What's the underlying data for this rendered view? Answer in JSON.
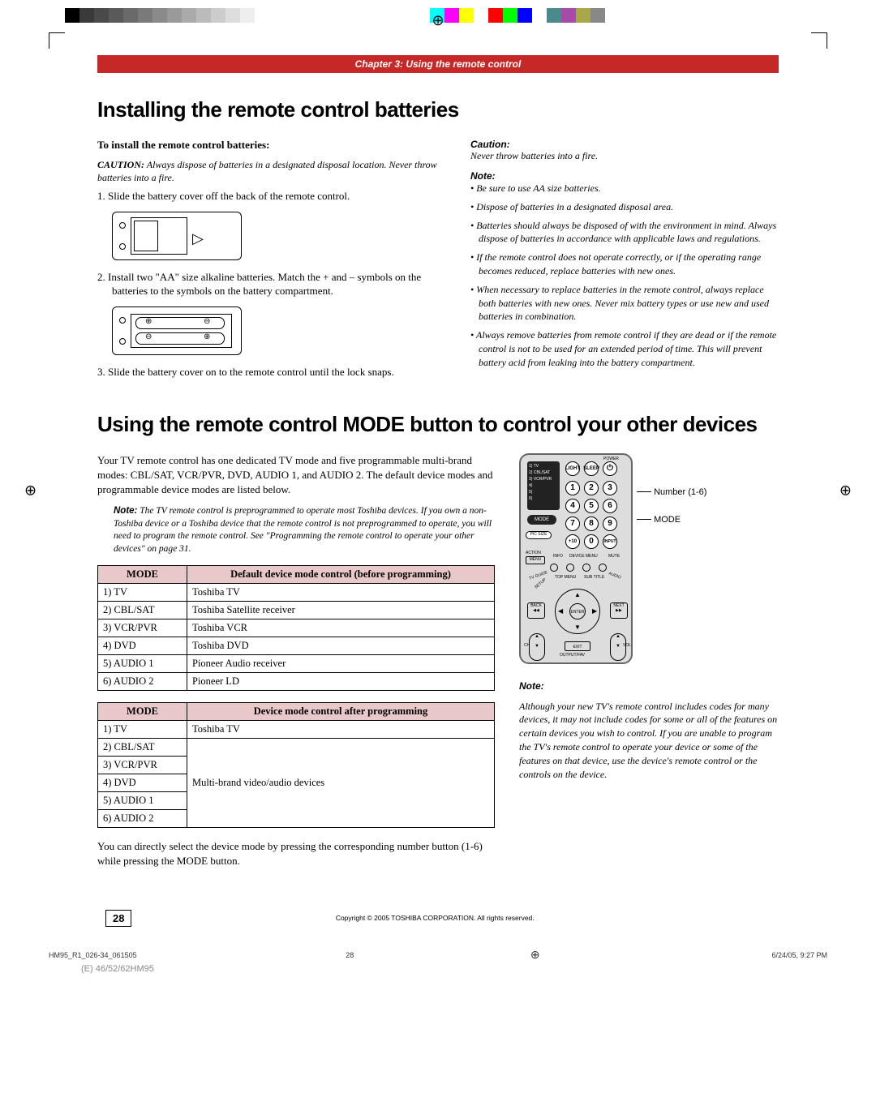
{
  "color_bar": [
    "#000",
    "#3a3a3a",
    "#4a4a4a",
    "#5a5a5a",
    "#6a6a6a",
    "#7a7a7a",
    "#8a8a8a",
    "#9a9a9a",
    "#aaa",
    "#bbb",
    "#ccc",
    "#ddd",
    "#eee",
    "#fff",
    "#fff",
    "#fff",
    "#fff",
    "#fff",
    "#fff",
    "#fff",
    "#fff",
    "#fff",
    "#fff",
    "#fff",
    "#fff",
    "#00ffff",
    "#ff00ff",
    "#ffff00",
    "#fff",
    "#ff0000",
    "#00ff00",
    "#0000ff",
    "#fff",
    "#4a8a8a",
    "#a84aa8",
    "#a8a84a",
    "#888"
  ],
  "chapter_header": "Chapter 3: Using the remote control",
  "heading1": "Installing the remote control batteries",
  "install_sub": "To install the remote control batteries:",
  "caution_label": "CAUTION:",
  "caution_text": " Always dispose of batteries in a designated disposal location. Never throw batteries into a fire.",
  "step1": "1. Slide the battery cover off the back of the remote control.",
  "step2": "2. Install two \"AA\" size alkaline batteries. Match the + and – symbols on the batteries to the symbols on the battery compartment.",
  "step3": "3. Slide the battery cover on to the remote control until the lock snaps.",
  "right_caution_label": "Caution:",
  "right_caution_text": "Never throw batteries into a fire.",
  "note_label": "Note:",
  "notes": [
    "Be sure to use AA size batteries.",
    "Dispose of batteries in a designated disposal area.",
    "Batteries should always be disposed of with the environment in mind. Always dispose of batteries in accordance with applicable laws and regulations.",
    "If the remote control does not operate correctly, or if the operating range becomes reduced, replace batteries with new ones.",
    "When necessary to replace batteries in the remote control, always replace both batteries with new ones. Never mix battery types or use new and used batteries in combination.",
    "Always remove batteries from remote control if they are dead or if the remote control is not to be used for an extended period of time. This will prevent battery acid from leaking into the battery compartment."
  ],
  "heading2": "Using the remote control MODE button to control your other devices",
  "intro_para": "Your TV remote control has one dedicated TV mode and five programmable multi-brand modes: CBL/SAT, VCR/PVR, DVD, AUDIO 1, and AUDIO 2. The default device modes and programmable device modes are listed below.",
  "inline_note_label": "Note:",
  "inline_note_text": " The TV remote control is preprogrammed to operate most Toshiba devices. If you own a non-Toshiba device or a Toshiba device that the remote control is not preprogrammed to operate, you will need to program the remote control. See \"Programming the remote control to operate your other devices\" on page 31.",
  "table1": {
    "headers": [
      "MODE",
      "Default device mode control (before programming)"
    ],
    "rows": [
      [
        "1) TV",
        "Toshiba TV"
      ],
      [
        "2) CBL/SAT",
        "Toshiba Satellite receiver"
      ],
      [
        "3) VCR/PVR",
        "Toshiba VCR"
      ],
      [
        "4) DVD",
        "Toshiba DVD"
      ],
      [
        "5) AUDIO 1",
        "Pioneer Audio receiver"
      ],
      [
        "6) AUDIO 2",
        "Pioneer LD"
      ]
    ]
  },
  "table2": {
    "headers": [
      "MODE",
      "Device mode control after programming"
    ],
    "rows_mode": [
      "1) TV",
      "2) CBL/SAT",
      "3) VCR/PVR",
      "4) DVD",
      "5) AUDIO 1",
      "6) AUDIO 2"
    ],
    "tv_val": "Toshiba TV",
    "multi_val": "Multi-brand video/audio devices"
  },
  "after_table_para": "You can directly select the device mode by pressing the corresponding number button (1-6) while pressing the MODE button.",
  "remote_labels": {
    "number": "Number (1-6)",
    "mode": "MODE"
  },
  "remote_note_label": "Note:",
  "remote_note_text": "Although your new TV's remote control includes codes for many devices, it may not include codes for some or all of the features on certain devices you wish to control. If you are unable to program the TV's remote control to operate your device or some of the features on that device, use the device's remote control or the controls on the device.",
  "page_number": "28",
  "copyright": "Copyright © 2005 TOSHIBA CORPORATION. All rights reserved.",
  "bottom_left": "HM95_R1_026-34_061505",
  "bottom_center": "28",
  "bottom_right": "6/24/05, 9:27 PM",
  "model": "(E) 46/52/62HM95"
}
